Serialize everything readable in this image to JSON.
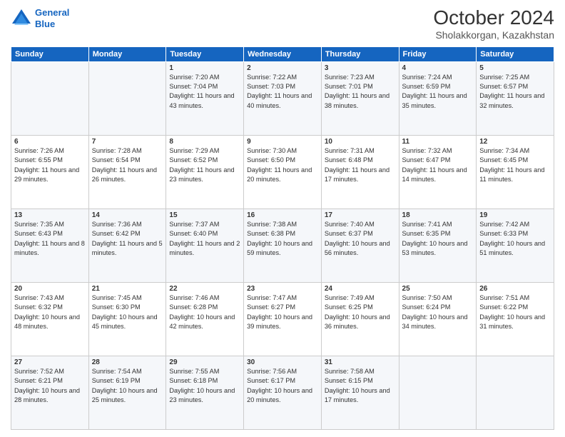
{
  "header": {
    "logo_line1": "General",
    "logo_line2": "Blue",
    "title": "October 2024",
    "subtitle": "Sholakkorgan, Kazakhstan"
  },
  "days_of_week": [
    "Sunday",
    "Monday",
    "Tuesday",
    "Wednesday",
    "Thursday",
    "Friday",
    "Saturday"
  ],
  "weeks": [
    [
      {
        "day": "",
        "sunrise": "",
        "sunset": "",
        "daylight": ""
      },
      {
        "day": "",
        "sunrise": "",
        "sunset": "",
        "daylight": ""
      },
      {
        "day": "1",
        "sunrise": "Sunrise: 7:20 AM",
        "sunset": "Sunset: 7:04 PM",
        "daylight": "Daylight: 11 hours and 43 minutes."
      },
      {
        "day": "2",
        "sunrise": "Sunrise: 7:22 AM",
        "sunset": "Sunset: 7:03 PM",
        "daylight": "Daylight: 11 hours and 40 minutes."
      },
      {
        "day": "3",
        "sunrise": "Sunrise: 7:23 AM",
        "sunset": "Sunset: 7:01 PM",
        "daylight": "Daylight: 11 hours and 38 minutes."
      },
      {
        "day": "4",
        "sunrise": "Sunrise: 7:24 AM",
        "sunset": "Sunset: 6:59 PM",
        "daylight": "Daylight: 11 hours and 35 minutes."
      },
      {
        "day": "5",
        "sunrise": "Sunrise: 7:25 AM",
        "sunset": "Sunset: 6:57 PM",
        "daylight": "Daylight: 11 hours and 32 minutes."
      }
    ],
    [
      {
        "day": "6",
        "sunrise": "Sunrise: 7:26 AM",
        "sunset": "Sunset: 6:55 PM",
        "daylight": "Daylight: 11 hours and 29 minutes."
      },
      {
        "day": "7",
        "sunrise": "Sunrise: 7:28 AM",
        "sunset": "Sunset: 6:54 PM",
        "daylight": "Daylight: 11 hours and 26 minutes."
      },
      {
        "day": "8",
        "sunrise": "Sunrise: 7:29 AM",
        "sunset": "Sunset: 6:52 PM",
        "daylight": "Daylight: 11 hours and 23 minutes."
      },
      {
        "day": "9",
        "sunrise": "Sunrise: 7:30 AM",
        "sunset": "Sunset: 6:50 PM",
        "daylight": "Daylight: 11 hours and 20 minutes."
      },
      {
        "day": "10",
        "sunrise": "Sunrise: 7:31 AM",
        "sunset": "Sunset: 6:48 PM",
        "daylight": "Daylight: 11 hours and 17 minutes."
      },
      {
        "day": "11",
        "sunrise": "Sunrise: 7:32 AM",
        "sunset": "Sunset: 6:47 PM",
        "daylight": "Daylight: 11 hours and 14 minutes."
      },
      {
        "day": "12",
        "sunrise": "Sunrise: 7:34 AM",
        "sunset": "Sunset: 6:45 PM",
        "daylight": "Daylight: 11 hours and 11 minutes."
      }
    ],
    [
      {
        "day": "13",
        "sunrise": "Sunrise: 7:35 AM",
        "sunset": "Sunset: 6:43 PM",
        "daylight": "Daylight: 11 hours and 8 minutes."
      },
      {
        "day": "14",
        "sunrise": "Sunrise: 7:36 AM",
        "sunset": "Sunset: 6:42 PM",
        "daylight": "Daylight: 11 hours and 5 minutes."
      },
      {
        "day": "15",
        "sunrise": "Sunrise: 7:37 AM",
        "sunset": "Sunset: 6:40 PM",
        "daylight": "Daylight: 11 hours and 2 minutes."
      },
      {
        "day": "16",
        "sunrise": "Sunrise: 7:38 AM",
        "sunset": "Sunset: 6:38 PM",
        "daylight": "Daylight: 10 hours and 59 minutes."
      },
      {
        "day": "17",
        "sunrise": "Sunrise: 7:40 AM",
        "sunset": "Sunset: 6:37 PM",
        "daylight": "Daylight: 10 hours and 56 minutes."
      },
      {
        "day": "18",
        "sunrise": "Sunrise: 7:41 AM",
        "sunset": "Sunset: 6:35 PM",
        "daylight": "Daylight: 10 hours and 53 minutes."
      },
      {
        "day": "19",
        "sunrise": "Sunrise: 7:42 AM",
        "sunset": "Sunset: 6:33 PM",
        "daylight": "Daylight: 10 hours and 51 minutes."
      }
    ],
    [
      {
        "day": "20",
        "sunrise": "Sunrise: 7:43 AM",
        "sunset": "Sunset: 6:32 PM",
        "daylight": "Daylight: 10 hours and 48 minutes."
      },
      {
        "day": "21",
        "sunrise": "Sunrise: 7:45 AM",
        "sunset": "Sunset: 6:30 PM",
        "daylight": "Daylight: 10 hours and 45 minutes."
      },
      {
        "day": "22",
        "sunrise": "Sunrise: 7:46 AM",
        "sunset": "Sunset: 6:28 PM",
        "daylight": "Daylight: 10 hours and 42 minutes."
      },
      {
        "day": "23",
        "sunrise": "Sunrise: 7:47 AM",
        "sunset": "Sunset: 6:27 PM",
        "daylight": "Daylight: 10 hours and 39 minutes."
      },
      {
        "day": "24",
        "sunrise": "Sunrise: 7:49 AM",
        "sunset": "Sunset: 6:25 PM",
        "daylight": "Daylight: 10 hours and 36 minutes."
      },
      {
        "day": "25",
        "sunrise": "Sunrise: 7:50 AM",
        "sunset": "Sunset: 6:24 PM",
        "daylight": "Daylight: 10 hours and 34 minutes."
      },
      {
        "day": "26",
        "sunrise": "Sunrise: 7:51 AM",
        "sunset": "Sunset: 6:22 PM",
        "daylight": "Daylight: 10 hours and 31 minutes."
      }
    ],
    [
      {
        "day": "27",
        "sunrise": "Sunrise: 7:52 AM",
        "sunset": "Sunset: 6:21 PM",
        "daylight": "Daylight: 10 hours and 28 minutes."
      },
      {
        "day": "28",
        "sunrise": "Sunrise: 7:54 AM",
        "sunset": "Sunset: 6:19 PM",
        "daylight": "Daylight: 10 hours and 25 minutes."
      },
      {
        "day": "29",
        "sunrise": "Sunrise: 7:55 AM",
        "sunset": "Sunset: 6:18 PM",
        "daylight": "Daylight: 10 hours and 23 minutes."
      },
      {
        "day": "30",
        "sunrise": "Sunrise: 7:56 AM",
        "sunset": "Sunset: 6:17 PM",
        "daylight": "Daylight: 10 hours and 20 minutes."
      },
      {
        "day": "31",
        "sunrise": "Sunrise: 7:58 AM",
        "sunset": "Sunset: 6:15 PM",
        "daylight": "Daylight: 10 hours and 17 minutes."
      },
      {
        "day": "",
        "sunrise": "",
        "sunset": "",
        "daylight": ""
      },
      {
        "day": "",
        "sunrise": "",
        "sunset": "",
        "daylight": ""
      }
    ]
  ]
}
